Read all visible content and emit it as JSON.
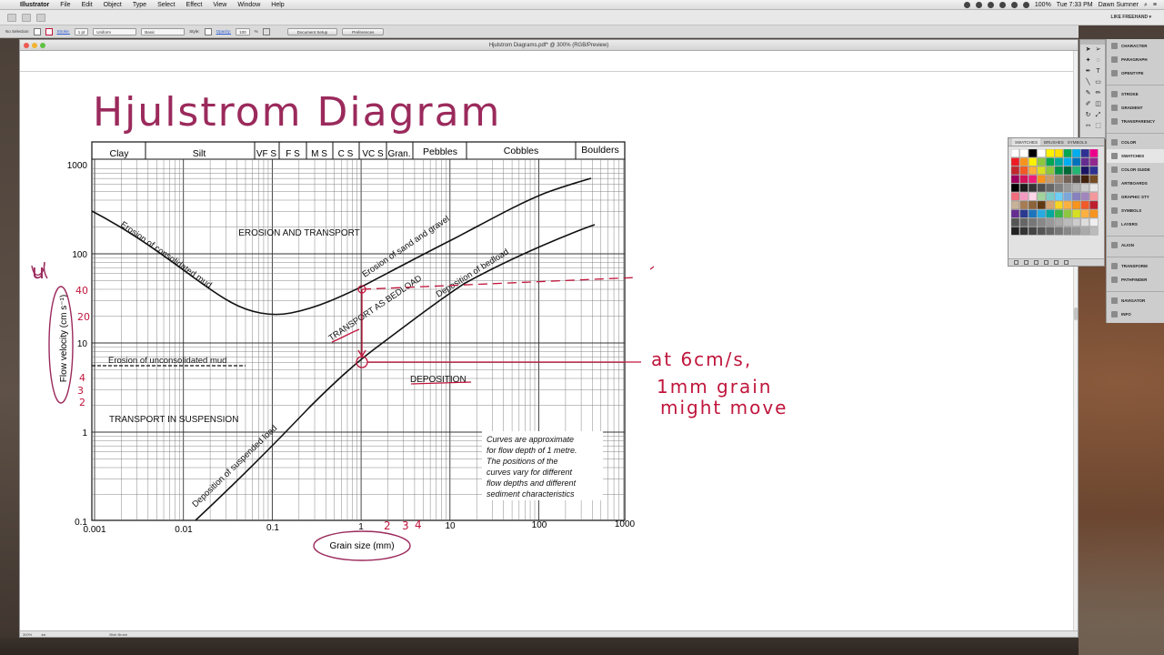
{
  "menubar": {
    "app_name": "Illustrator",
    "items": [
      "File",
      "Edit",
      "Object",
      "Type",
      "Select",
      "Effect",
      "View",
      "Window",
      "Help"
    ],
    "battery": "100%",
    "clock": "Tue 7:33 PM",
    "user": "Dawn Sumner"
  },
  "appbar": {
    "workspace": "LIKE FREEHAND ▾"
  },
  "controlbar": {
    "selection": "No Selection",
    "stroke_label": "Stroke:",
    "stroke_value": "1 pt",
    "profile_label": "Uniform",
    "brush_label": "Basic",
    "style_label": "Style:",
    "opacity_label": "Opacity:",
    "opacity_value": "100",
    "opacity_unit": "%",
    "document_setup": "Document Setup",
    "preferences": "Preferences"
  },
  "document": {
    "title": "Hjulstrom Diagrams.pdf* @ 300% (RGB/Preview)",
    "status_zoom": "300%",
    "status_tool": "Blob Brush"
  },
  "diagram": {
    "handwritten_title": "Hjulstrom Diagram",
    "size_classes": [
      "Clay",
      "Silt",
      "VF S",
      "F S",
      "M S",
      "C S",
      "VC S",
      "Gran.",
      "Pebbles",
      "Cobbles",
      "Boulders"
    ],
    "y_ticks": [
      "1000",
      "100",
      "10",
      "1",
      "0.1"
    ],
    "x_ticks": [
      "0.001",
      "0.01",
      "0.1",
      "1",
      "10",
      "100",
      "1000"
    ],
    "y_axis_label": "Flow velocity (cm s⁻¹)",
    "x_axis_label": "Grain size (mm)",
    "labels": {
      "erosion_transport": "EROSION AND TRANSPORT",
      "erosion_consolidated": "Erosion of consolidated mud",
      "erosion_sand_gravel": "Erosion of sand and gravel",
      "deposition_bedload": "Deposition of bedload",
      "transport_bedload": "TRANSPORT AS BEDLOAD",
      "erosion_unconsolidated": "Erosion of unconsolidated mud",
      "deposition": "DEPOSITION",
      "transport_suspension": "TRANSPORT IN SUSPENSION",
      "deposition_suspended": "Deposition of suspended load"
    },
    "note": [
      "Curves are approximate",
      "for flow depth of 1 metre.",
      "The positions of the",
      "curves vary for different",
      "flow depths and different",
      "sediment characteristics"
    ],
    "annotations": {
      "u_symbol": "u",
      "v40": "40",
      "v20": "20",
      "v4": "4",
      "v3": "3",
      "v2": "2",
      "g2": "2",
      "g3": "3",
      "g4": "4",
      "note_line1": "at 6cm/s,",
      "note_line2": "1mm grain",
      "note_line3": "might move"
    },
    "ink_color": "#c0163c"
  },
  "panels": {
    "swatches_tabs": [
      "SWATCHES",
      "BRUSHES",
      "SYMBOLS"
    ],
    "dock": [
      "CHARACTER",
      "PARAGRAPH",
      "OPENTYPE",
      "STROKE",
      "GRADIENT",
      "TRANSPARENCY",
      "COLOR",
      "SWATCHES",
      "COLOR GUIDE",
      "ARTBOARDS",
      "GRAPHIC STY",
      "SYMBOLS",
      "LAYERS",
      "ALIGN",
      "TRANSFORM",
      "PATHFINDER",
      "NAVIGATOR",
      "INFO"
    ]
  }
}
